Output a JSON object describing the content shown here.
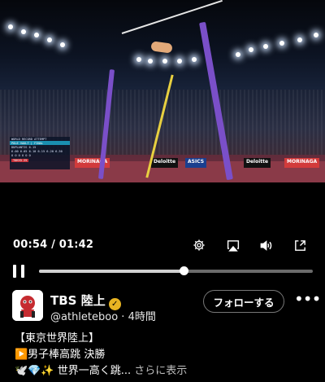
{
  "video": {
    "scoreboard": {
      "header": "WORLD RECORD ATTEMPT",
      "event": "POLE VAULT | FINAL",
      "athlete_row": "DUPLANTIS",
      "athlete_mark": "6.15",
      "attempts": "6.00  6.05  6.10  6.15  6.20  6.30",
      "results": "O O O O O O",
      "location": "TOKYO 25"
    },
    "banners": [
      "MORINAGA",
      "Deloitte",
      "ASICS",
      "Deloitte",
      "MORINAGA"
    ]
  },
  "player": {
    "current_time": "00:54",
    "duration": "01:42",
    "time_separator": " / ",
    "progress_fraction": 0.529
  },
  "icons": {
    "settings": "gear-icon",
    "airplay": "airplay-icon",
    "volume": "speaker-icon",
    "minimize": "minimize-icon",
    "pause": "pause-icon",
    "verified": "verified-badge-icon",
    "more": "more-dots-icon"
  },
  "post": {
    "display_name": "TBS 陸上",
    "handle": "@athleteboo",
    "time_ago": "4時間",
    "follow_label": "フォローする",
    "lines": [
      "【東京世界陸上】",
      "▶️男子棒高跳 決勝",
      "🕊️💎✨ 世界一高く跳..."
    ],
    "show_more": "さらに表示"
  },
  "colors": {
    "background": "#000000",
    "verified": "#e8b422",
    "standards": "#7a4fc8"
  }
}
